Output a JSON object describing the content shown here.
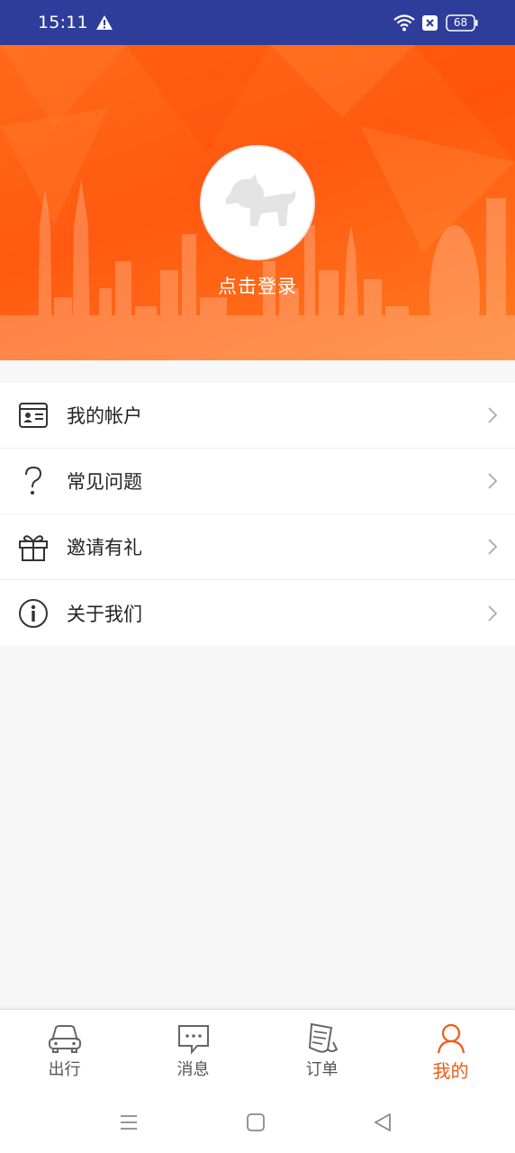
{
  "status_bar": {
    "time": "15:11",
    "battery": "68",
    "icons": [
      "alert-icon",
      "wifi-icon",
      "sim-off-icon",
      "battery-icon"
    ]
  },
  "profile": {
    "login_label": "点击登录",
    "avatar_icon": "horse-placeholder-icon"
  },
  "menu": {
    "items": [
      {
        "label": "我的帐户",
        "icon": "id-card-icon"
      },
      {
        "label": "常见问题",
        "icon": "question-icon"
      },
      {
        "label": "邀请有礼",
        "icon": "gift-icon"
      },
      {
        "label": "关于我们",
        "icon": "info-icon"
      }
    ]
  },
  "tabbar": {
    "tabs": [
      {
        "label": "出行",
        "icon": "car-icon",
        "active": false
      },
      {
        "label": "消息",
        "icon": "message-icon",
        "active": false
      },
      {
        "label": "订单",
        "icon": "order-icon",
        "active": false
      },
      {
        "label": "我的",
        "icon": "person-icon",
        "active": true
      }
    ]
  },
  "colors": {
    "status_bar": "#2f3d9a",
    "accent": "#f25a12",
    "hero": "#ff6a1a"
  }
}
